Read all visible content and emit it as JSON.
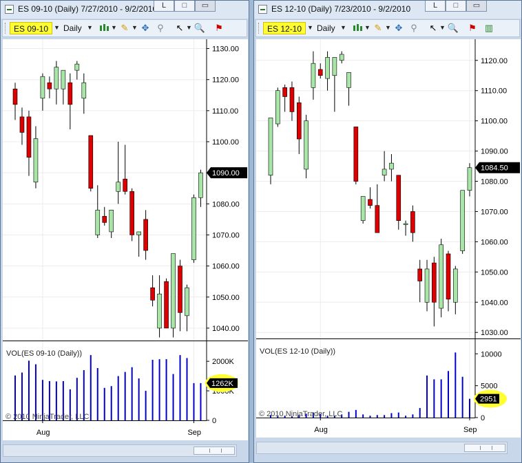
{
  "windows": [
    {
      "title": "ES 09-10 (Daily)  7/27/2010 - 9/2/2010",
      "instrument": "ES 09-10",
      "interval": "Daily",
      "close_btn_label": "L",
      "price_ticks": [
        "1130.00",
        "1120.00",
        "1110.00",
        "1100.00",
        "1090.00",
        "1080.00",
        "1070.00",
        "1060.00",
        "1050.00",
        "1040.00"
      ],
      "price_flag": "1090.00",
      "vol_label": "VOL(ES 09-10 (Daily))",
      "vol_ticks": [
        "2000K",
        "1000K",
        "0"
      ],
      "vol_flag": "1262K",
      "copyright": "© 2010 NinjaTrader, LLC",
      "date_ticks": [
        "Aug",
        "Sep"
      ]
    },
    {
      "title": "ES 12-10 (Daily)  7/23/2010 - 9/2/2010",
      "instrument": "ES 12-10",
      "interval": "Daily",
      "close_btn_label": "L",
      "price_ticks": [
        "1120.00",
        "1110.00",
        "1100.00",
        "1090.00",
        "1080.00",
        "1070.00",
        "1060.00",
        "1050.00",
        "1040.00",
        "1030.00"
      ],
      "price_flag": "1084.50",
      "vol_label": "VOL(ES 12-10 (Daily))",
      "vol_ticks": [
        "10000",
        "5000",
        "0"
      ],
      "vol_flag": "2951",
      "copyright": "© 2010 NinjaTrader, LLC",
      "date_ticks": [
        "Aug",
        "Sep"
      ]
    }
  ],
  "colors": {
    "up": "#a8e6a8",
    "down": "#dd0000",
    "volume": "#0000cc",
    "highlight": "#ffff33",
    "flag": "#000000"
  },
  "toolbar_icons": [
    "candlestick-icon",
    "pencil-icon",
    "crosshair-icon",
    "zoom-tool-icon",
    "cursor-arrow-icon",
    "magnifier-icon",
    "indicators-icon"
  ],
  "chart_data": [
    {
      "type": "candlestick",
      "instrument": "ES 09-10",
      "ylim": [
        1036,
        1133
      ],
      "candles": [
        {
          "o": 1117,
          "h": 1119,
          "l": 1107,
          "c": 1112
        },
        {
          "o": 1108,
          "h": 1111,
          "l": 1099,
          "c": 1103
        },
        {
          "o": 1108,
          "h": 1110,
          "l": 1089,
          "c": 1095
        },
        {
          "o": 1087,
          "h": 1105,
          "l": 1085,
          "c": 1101
        },
        {
          "o": 1114,
          "h": 1122,
          "l": 1110,
          "c": 1121
        },
        {
          "o": 1119,
          "h": 1121,
          "l": 1114,
          "c": 1117
        },
        {
          "o": 1117,
          "h": 1126,
          "l": 1112,
          "c": 1124
        },
        {
          "o": 1117,
          "h": 1123,
          "l": 1112,
          "c": 1123
        },
        {
          "o": 1119,
          "h": 1122,
          "l": 1104,
          "c": 1112
        },
        {
          "o": 1123,
          "h": 1126,
          "l": 1120,
          "c": 1125
        },
        {
          "o": 1114,
          "h": 1122,
          "l": 1109,
          "c": 1119
        },
        {
          "o": 1102,
          "h": 1102,
          "l": 1084,
          "c": 1085
        },
        {
          "o": 1070,
          "h": 1086,
          "l": 1069,
          "c": 1078
        },
        {
          "o": 1076,
          "h": 1079,
          "l": 1073,
          "c": 1074
        },
        {
          "o": 1071,
          "h": 1078,
          "l": 1069,
          "c": 1078
        },
        {
          "o": 1084,
          "h": 1100,
          "l": 1080,
          "c": 1087
        },
        {
          "o": 1088,
          "h": 1099,
          "l": 1083,
          "c": 1084
        },
        {
          "o": 1084,
          "h": 1085,
          "l": 1068,
          "c": 1070
        },
        {
          "o": 1070,
          "h": 1071,
          "l": 1063,
          "c": 1071
        },
        {
          "o": 1075,
          "h": 1078,
          "l": 1062,
          "c": 1065
        },
        {
          "o": 1053,
          "h": 1057,
          "l": 1047,
          "c": 1049
        },
        {
          "o": 1040,
          "h": 1057,
          "l": 1037,
          "c": 1051
        },
        {
          "o": 1055,
          "h": 1056,
          "l": 1040,
          "c": 1040
        },
        {
          "o": 1040,
          "h": 1064,
          "l": 1037,
          "c": 1064
        },
        {
          "o": 1060,
          "h": 1062,
          "l": 1039,
          "c": 1045
        },
        {
          "o": 1044,
          "h": 1054,
          "l": 1039,
          "c": 1053
        },
        {
          "o": 1062,
          "h": 1083,
          "l": 1061,
          "c": 1082
        },
        {
          "o": 1082,
          "h": 1091,
          "l": 1079,
          "c": 1090
        }
      ],
      "volume_k": [
        1520,
        1620,
        2020,
        1900,
        1370,
        1330,
        1320,
        1330,
        1050,
        1440,
        1700,
        2210,
        1770,
        1100,
        1160,
        1500,
        1640,
        1800,
        1420,
        1000,
        2050,
        2070,
        2070,
        1570,
        2210,
        2110,
        1260,
        1262
      ],
      "date_ticks": [
        "Aug",
        "Sep"
      ]
    },
    {
      "type": "candlestick",
      "instrument": "ES 12-10",
      "ylim": [
        1028,
        1127
      ],
      "candles": [
        {
          "o": 1082,
          "h": 1101,
          "l": 1079,
          "c": 1101
        },
        {
          "o": 1099,
          "h": 1111,
          "l": 1098,
          "c": 1110
        },
        {
          "o": 1111,
          "h": 1112,
          "l": 1103,
          "c": 1108
        },
        {
          "o": 1111,
          "h": 1113,
          "l": 1100,
          "c": 1103
        },
        {
          "o": 1106,
          "h": 1108,
          "l": 1089,
          "c": 1094
        },
        {
          "o": 1084,
          "h": 1102,
          "l": 1081,
          "c": 1100
        },
        {
          "o": 1111,
          "h": 1123,
          "l": 1107,
          "c": 1119
        },
        {
          "o": 1117,
          "h": 1119,
          "l": 1114,
          "c": 1115
        },
        {
          "o": 1114,
          "h": 1123,
          "l": 1110,
          "c": 1121
        },
        {
          "o": 1115,
          "h": 1121,
          "l": 1103,
          "c": 1121
        },
        {
          "o": 1120,
          "h": 1123,
          "l": 1119,
          "c": 1122
        },
        {
          "o": 1111,
          "h": 1116,
          "l": 1105,
          "c": 1116
        },
        {
          "o": 1098,
          "h": 1098,
          "l": 1079,
          "c": 1080
        },
        {
          "o": 1067,
          "h": 1075,
          "l": 1066,
          "c": 1075
        },
        {
          "o": 1074,
          "h": 1078,
          "l": 1071,
          "c": 1072
        },
        {
          "o": 1072,
          "h": 1079,
          "l": 1064,
          "c": 1063
        },
        {
          "o": 1082,
          "h": 1090,
          "l": 1080,
          "c": 1084
        },
        {
          "o": 1084,
          "h": 1089,
          "l": 1080,
          "c": 1086
        },
        {
          "o": 1082,
          "h": 1082,
          "l": 1064,
          "c": 1067
        },
        {
          "o": 1066,
          "h": 1067,
          "l": 1062,
          "c": 1066
        },
        {
          "o": 1070,
          "h": 1072,
          "l": 1060,
          "c": 1063
        },
        {
          "o": 1051,
          "h": 1054,
          "l": 1040,
          "c": 1047
        },
        {
          "o": 1040,
          "h": 1054,
          "l": 1037,
          "c": 1051
        },
        {
          "o": 1053,
          "h": 1055,
          "l": 1032,
          "c": 1040
        },
        {
          "o": 1038,
          "h": 1061,
          "l": 1035,
          "c": 1059
        },
        {
          "o": 1056,
          "h": 1057,
          "l": 1037,
          "c": 1041
        },
        {
          "o": 1040,
          "h": 1052,
          "l": 1036,
          "c": 1051
        },
        {
          "o": 1057,
          "h": 1077,
          "l": 1056,
          "c": 1077
        },
        {
          "o": 1077,
          "h": 1086,
          "l": 1075,
          "c": 1084.5
        }
      ],
      "volume": [
        400,
        200,
        300,
        200,
        400,
        600,
        800,
        600,
        300,
        300,
        500,
        900,
        1200,
        500,
        300,
        400,
        400,
        700,
        800,
        300,
        500,
        1500,
        6600,
        6000,
        6000,
        7300,
        10200,
        6400,
        2951
      ],
      "date_ticks": [
        "Aug",
        "Sep"
      ]
    }
  ]
}
